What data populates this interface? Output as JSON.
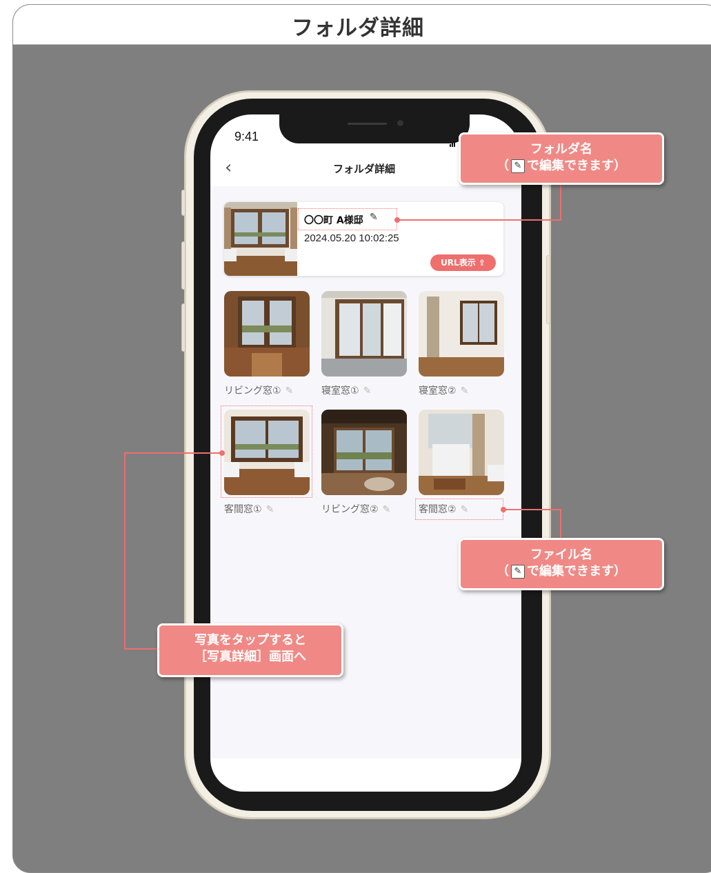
{
  "frame": {
    "title": "フォルダ詳細"
  },
  "status_bar": {
    "time": "9:41"
  },
  "nav": {
    "back_icon": "‹",
    "title": "フォルダ詳細"
  },
  "folder": {
    "name": "〇〇町 A様邸",
    "edit_icon": "✎",
    "date": "2024.05.20 10:02:25",
    "url_button": "URL表示 ⇪"
  },
  "photos": [
    {
      "label": "リビング窓①"
    },
    {
      "label": "寝室窓①"
    },
    {
      "label": "寝室窓②"
    },
    {
      "label": "客間窓①"
    },
    {
      "label": "リビング窓②"
    },
    {
      "label": "客間窓②"
    }
  ],
  "callouts": {
    "folder_name": {
      "line1": "フォルダ名",
      "line2_pre": "（",
      "line2_post": "で編集できます）"
    },
    "file_name": {
      "line1": "ファイル名",
      "line2_pre": "（",
      "line2_post": "で編集できます）"
    },
    "tap_photo": {
      "line1": "写真をタップすると",
      "line2": "［写真詳細］画面へ"
    }
  },
  "colors": {
    "accent": "#ee6f6d",
    "callout": "#f08985",
    "backdrop": "#7f7f7f"
  }
}
